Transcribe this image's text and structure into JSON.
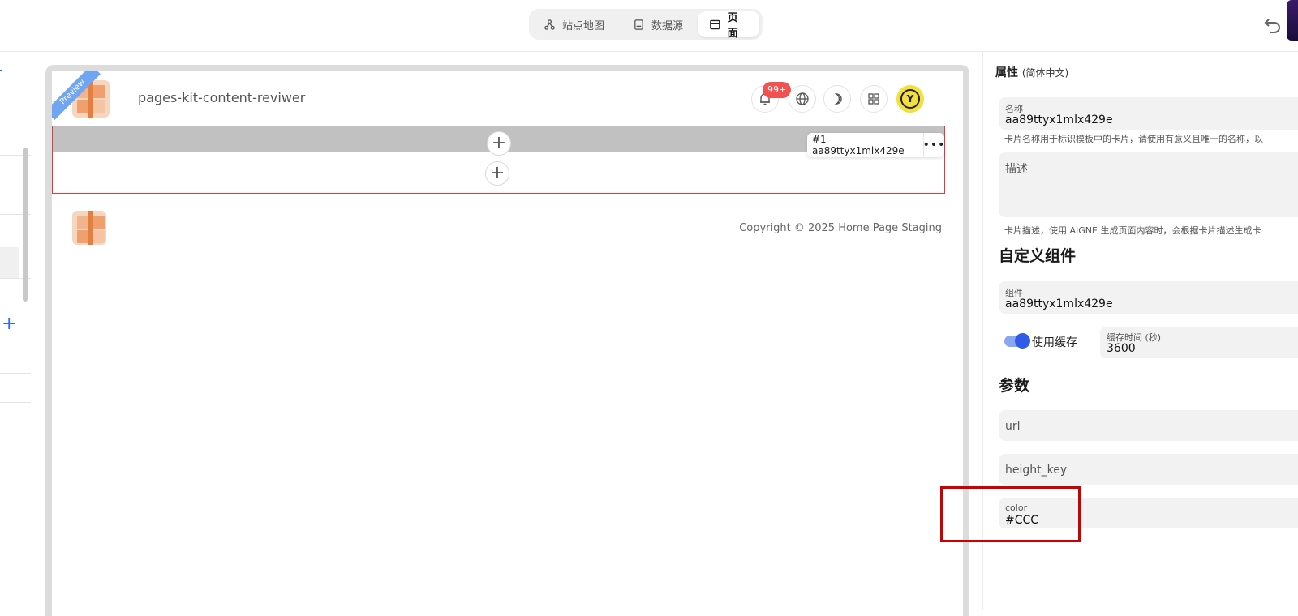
{
  "topbar": {
    "tabs": [
      {
        "label": "站点地图",
        "icon": "sitemap-icon"
      },
      {
        "label": "数据源",
        "icon": "datasource-icon"
      },
      {
        "label": "页面",
        "icon": "page-icon"
      }
    ],
    "active_tab": "页面"
  },
  "canvas": {
    "ribbon": "Preview",
    "site_title": "pages-kit-content-reviwer",
    "notification_badge": "99+",
    "avatar_letter": "Y",
    "block_label": "#1 aa89ttyx1mlx429e",
    "block_more": "•••",
    "copyright": "Copyright © 2025 Home Page Staging"
  },
  "panel": {
    "title": "属性",
    "lang": "(简体中文)",
    "name_label": "名称",
    "name_value": "aa89ttyx1mlx429e",
    "name_hint": "卡片名称用于标识模板中的卡片，请使用有意义且唯一的名称，以",
    "desc_placeholder": "描述",
    "desc_hint": "卡片描述，使用 AIGNE 生成页面内容时，会根据卡片描述生成卡",
    "custom_section": "自定义组件",
    "component_label": "组件",
    "component_value": "aa89ttyx1mlx429e",
    "use_cache_label": "使用缓存",
    "use_cache_on": true,
    "cache_time_label": "缓存时间 (秒)",
    "cache_time_value": "3600",
    "params_section": "参数",
    "param_url": "url",
    "param_height_key": "height_key",
    "color_label": "color",
    "color_value": "#CCC"
  },
  "colors": {
    "accent": "#2f5be8",
    "block_border": "#e03b3b",
    "highlight": "#cc0000"
  }
}
